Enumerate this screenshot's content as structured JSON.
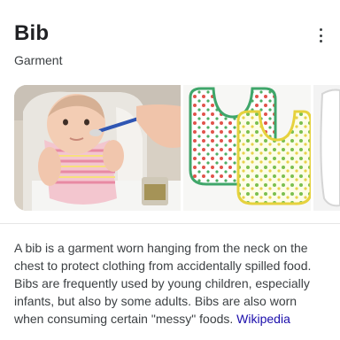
{
  "header": {
    "title": "Bib",
    "subtitle": "Garment",
    "menu_icon": "more-vert-icon"
  },
  "images": [
    {
      "subject": "baby in high chair being spoon fed, wearing bib"
    },
    {
      "subject": "two patterned bibs (red and green prints)"
    },
    {
      "subject": "partially visible white bib"
    }
  ],
  "description": {
    "text": "A bib is a garment worn hanging from the neck on the chest to protect clothing from accidentally spilled food. Bibs are frequently used by young children, especially infants, but also by some adults. Bibs are also worn when consuming certain \"messy\" foods.",
    "source_link": "Wikipedia"
  }
}
